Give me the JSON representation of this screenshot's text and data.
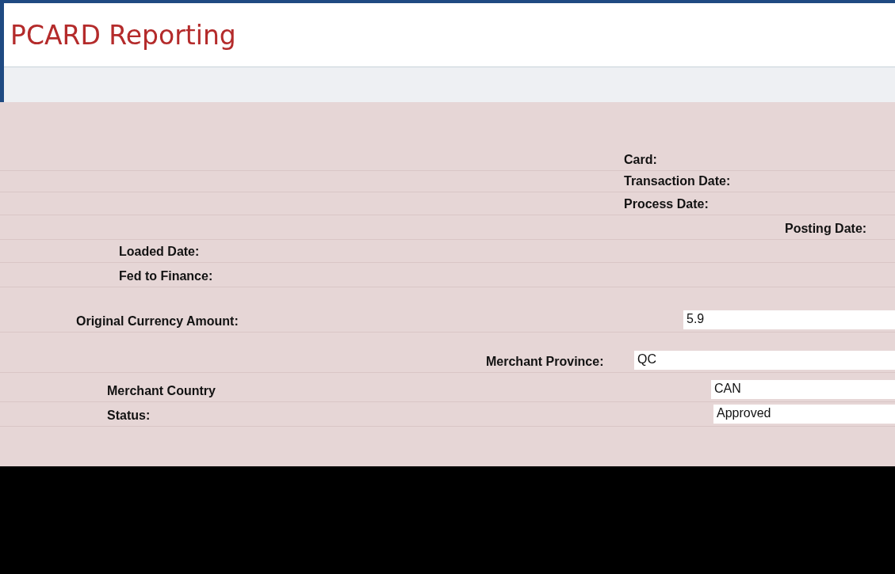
{
  "header": {
    "title": "PCARD Reporting"
  },
  "fields": [
    {
      "label": "Card:"
    },
    {
      "label": "Transaction Date:"
    },
    {
      "label": "Process Date:"
    },
    {
      "label": "Posting Date:"
    },
    {
      "label": "Loaded Date:"
    },
    {
      "label": "Fed to Finance:"
    },
    {
      "label": "Original Currency Amount:",
      "value": "5.9"
    },
    {
      "label": "Merchant Province:",
      "value": "QC"
    },
    {
      "label": "Merchant Country",
      "value": "CAN"
    },
    {
      "label": "Status:",
      "value": "Approved"
    }
  ]
}
